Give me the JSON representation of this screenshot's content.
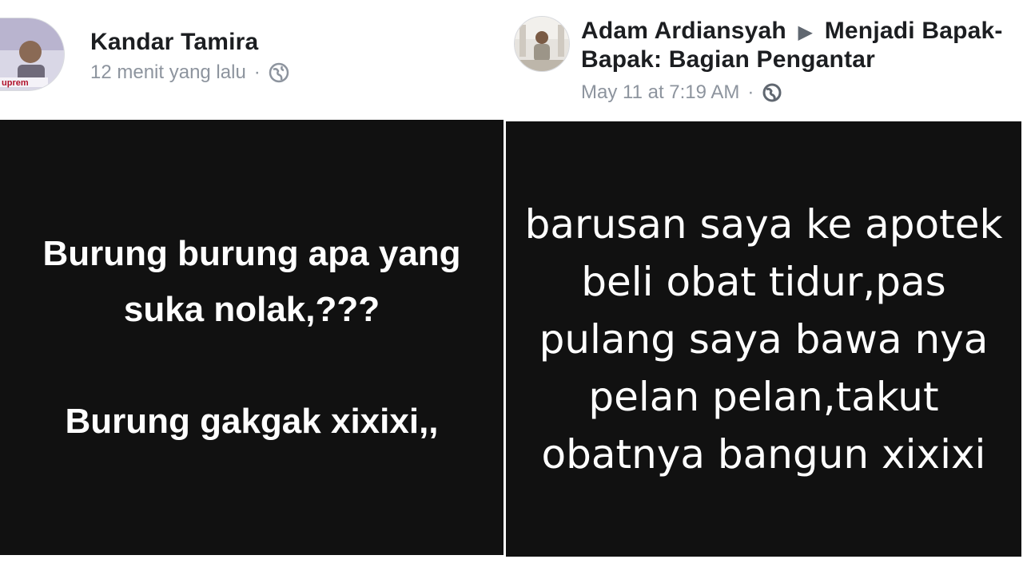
{
  "left_post": {
    "author": "Kandar Tamira",
    "timestamp": "12 menit yang lalu",
    "separator": "·",
    "privacy_icon": "globe-icon",
    "card_lines": [
      "Burung burung apa yang suka nolak,???",
      "Burung gakgak xixixi,,"
    ],
    "card_background": "#111111",
    "card_text_color": "#ffffff"
  },
  "right_post": {
    "author": "Adam Ardiansyah",
    "arrow": "▶",
    "group": "Menjadi Bapak-Bapak: Bagian Pengantar",
    "timestamp": "May 11 at 7:19 AM",
    "separator": "·",
    "privacy_icon": "globe-icon",
    "card_lines": [
      "barusan saya ke apotek",
      "beli obat tidur,pas",
      "pulang saya bawa nya",
      "pelan pelan,takut",
      "obatnya bangun xixixi"
    ],
    "card_background": "#111111",
    "card_text_color": "#ffffff"
  },
  "colors": {
    "author_text": "#1c1e21",
    "meta_text": "#8d949e",
    "page_background": "#ffffff"
  }
}
